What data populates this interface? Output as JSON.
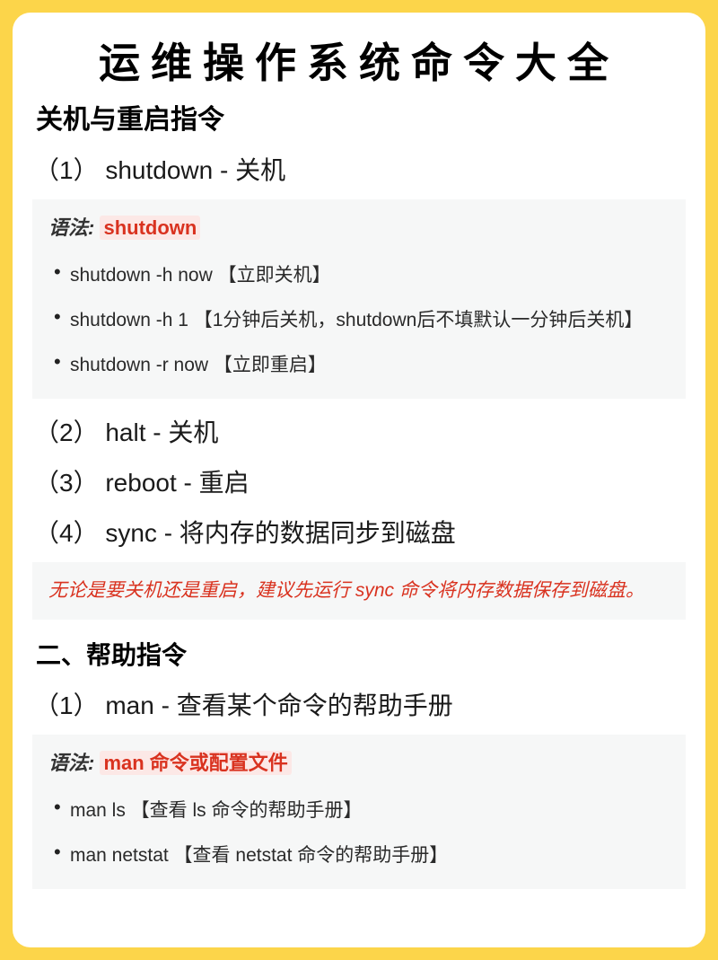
{
  "title": "运维操作系统命令大全",
  "section1": {
    "heading": "关机与重启指令",
    "items": [
      {
        "label": "（1） shutdown - 关机"
      },
      {
        "label": "（2） halt - 关机"
      },
      {
        "label": "（3） reboot - 重启"
      },
      {
        "label": "（4） sync - 将内存的数据同步到磁盘"
      }
    ],
    "syntax1": {
      "prefix": "语法:",
      "cmd": "shutdown",
      "options": [
        "shutdown -h now 【立即关机】",
        "shutdown -h 1 【1分钟后关机，shutdown后不填默认一分钟后关机】",
        "shutdown -r now 【立即重启】"
      ]
    },
    "note": "无论是要关机还是重启，建议先运行 sync 命令将内存数据保存到磁盘。"
  },
  "section2": {
    "heading": "二、帮助指令",
    "items": [
      {
        "label": "（1） man - 查看某个命令的帮助手册"
      }
    ],
    "syntax1": {
      "prefix": "语法:",
      "cmd": "man 命令或配置文件",
      "options": [
        "man ls 【查看 ls 命令的帮助手册】",
        "man netstat 【查看 netstat 命令的帮助手册】"
      ]
    }
  }
}
